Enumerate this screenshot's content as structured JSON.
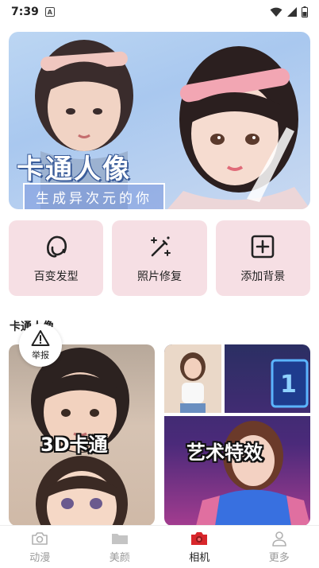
{
  "status_bar": {
    "time": "7:39",
    "notification_icon": "A"
  },
  "banner": {
    "title": "卡通人像",
    "subtitle": "生成异次元的你",
    "dots_count": 4,
    "active_dot": 0
  },
  "features": [
    {
      "label": "百变发型",
      "icon": "hair-icon"
    },
    {
      "label": "照片修复",
      "icon": "magic-wand-icon"
    },
    {
      "label": "添加背景",
      "icon": "add-square-icon"
    }
  ],
  "section": {
    "title": "卡通人像"
  },
  "report": {
    "label": "举报"
  },
  "cards": [
    {
      "label": "3D卡通"
    },
    {
      "label": "艺术特效"
    }
  ],
  "bottom_nav": [
    {
      "label": "动漫",
      "icon": "camera-outline-icon",
      "active": false
    },
    {
      "label": "美颜",
      "icon": "folder-icon",
      "active": false
    },
    {
      "label": "相机",
      "icon": "camera-filled-icon",
      "active": true
    },
    {
      "label": "更多",
      "icon": "person-icon",
      "active": false
    }
  ],
  "colors": {
    "accent": "#d8262b",
    "feature_bg": "#f6dfe4",
    "dot_active": "#f07090",
    "nav_inactive": "#9a9a9a"
  }
}
